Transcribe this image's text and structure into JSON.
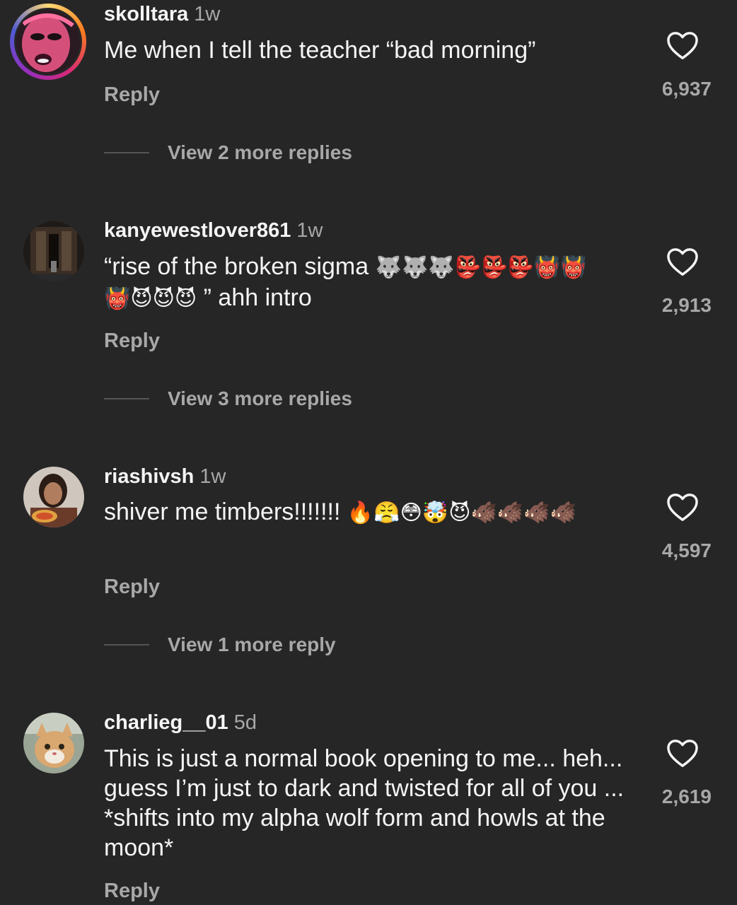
{
  "comments": [
    {
      "username": "skolltara",
      "time": "1w",
      "text": "Me when I tell the teacher “bad morning”",
      "text_emoji": "",
      "reply_label": "Reply",
      "view_replies": "View 2 more replies",
      "likes": "6,937"
    },
    {
      "username": "kanyewestlover861",
      "time": "1w",
      "text": "“rise of the broken sigma",
      "text_emoji": "🐺🐺🐺👺👺👺👹👹👹😈😈😈",
      "text_tail": "” ahh intro",
      "reply_label": "Reply",
      "view_replies": "View 3 more replies",
      "likes": "2,913"
    },
    {
      "username": "riashivsh",
      "time": "1w",
      "text": "shiver me timbers!!!!!!!",
      "text_emoji": "🔥😤😳🤯😈🐗🐗🐗🐗",
      "reply_label": "Reply",
      "view_replies": "View 1 more reply",
      "likes": "4,597"
    },
    {
      "username": "charlieg__01",
      "time": "5d",
      "text": "This is just a normal book opening to me... heh... guess I’m just to dark and twisted for all of you ... *shifts into my alpha wolf form and howls at the moon*",
      "text_emoji": "",
      "reply_label": "Reply",
      "likes": "2,619"
    }
  ],
  "icons": {
    "like": "heart-outline-icon"
  },
  "colors": {
    "background": "#262626",
    "primary_text": "#f5f5f5",
    "secondary_text": "#a8a8a8"
  }
}
